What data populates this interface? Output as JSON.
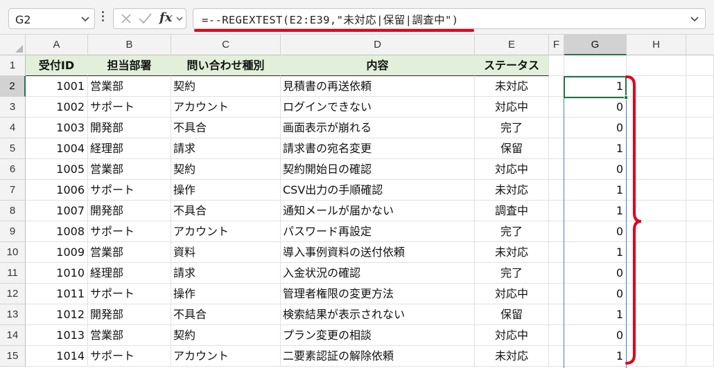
{
  "name_box": {
    "value": "G2"
  },
  "formula_bar": {
    "fx_label": "fx",
    "formula": "=--REGEXTEST(E2:E39,\"未対応|保留|調査中\")"
  },
  "columns": [
    "A",
    "B",
    "C",
    "D",
    "E",
    "F",
    "G",
    "H"
  ],
  "selected_column": "G",
  "rows": [
    "1",
    "2",
    "3",
    "4",
    "5",
    "6",
    "7",
    "8",
    "9",
    "10",
    "11",
    "12",
    "13",
    "14",
    "15"
  ],
  "selected_row": "2",
  "header_row": [
    "受付ID",
    "担当部署",
    "問い合わせ種別",
    "内容",
    "ステータス"
  ],
  "records": [
    {
      "id": "1001",
      "dept": "営業部",
      "type": "契約",
      "content": "見積書の再送依頼",
      "status": "未対応",
      "g": "1"
    },
    {
      "id": "1002",
      "dept": "サポート",
      "type": "アカウント",
      "content": "ログインできない",
      "status": "対応中",
      "g": "0"
    },
    {
      "id": "1003",
      "dept": "開発部",
      "type": "不具合",
      "content": "画面表示が崩れる",
      "status": "完了",
      "g": "0"
    },
    {
      "id": "1004",
      "dept": "経理部",
      "type": "請求",
      "content": "請求書の宛名変更",
      "status": "保留",
      "g": "1"
    },
    {
      "id": "1005",
      "dept": "営業部",
      "type": "契約",
      "content": "契約開始日の確認",
      "status": "対応中",
      "g": "0"
    },
    {
      "id": "1006",
      "dept": "サポート",
      "type": "操作",
      "content": "CSV出力の手順確認",
      "status": "未対応",
      "g": "1"
    },
    {
      "id": "1007",
      "dept": "開発部",
      "type": "不具合",
      "content": "通知メールが届かない",
      "status": "調査中",
      "g": "1"
    },
    {
      "id": "1008",
      "dept": "サポート",
      "type": "アカウント",
      "content": "パスワード再設定",
      "status": "完了",
      "g": "0"
    },
    {
      "id": "1009",
      "dept": "営業部",
      "type": "資料",
      "content": "導入事例資料の送付依頼",
      "status": "未対応",
      "g": "1"
    },
    {
      "id": "1010",
      "dept": "経理部",
      "type": "請求",
      "content": "入金状況の確認",
      "status": "完了",
      "g": "0"
    },
    {
      "id": "1011",
      "dept": "サポート",
      "type": "操作",
      "content": "管理者権限の変更方法",
      "status": "対応中",
      "g": "0"
    },
    {
      "id": "1012",
      "dept": "開発部",
      "type": "不具合",
      "content": "検索結果が表示されない",
      "status": "保留",
      "g": "1"
    },
    {
      "id": "1013",
      "dept": "営業部",
      "type": "契約",
      "content": "プラン変更の相談",
      "status": "対応中",
      "g": "0"
    },
    {
      "id": "1014",
      "dept": "サポート",
      "type": "アカウント",
      "content": "二要素認証の解除依頼",
      "status": "未対応",
      "g": "1"
    }
  ],
  "colors": {
    "header_fill": "#e2efda",
    "selection": "#217346",
    "annotation_red": "#e0001b"
  },
  "icons": [
    "chevron-down-icon",
    "more-vertical-icon",
    "cancel-icon",
    "enter-icon",
    "insert-function-icon",
    "expand-formula-bar-icon"
  ]
}
